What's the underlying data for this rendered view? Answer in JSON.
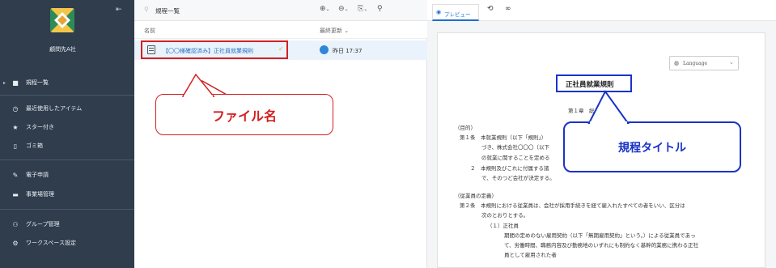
{
  "sidebar": {
    "collapse_icon": "⇤",
    "company": "顧問先A社",
    "items": [
      {
        "icon": "folder-icon",
        "label": "規程一覧",
        "has_caret": true
      },
      {
        "icon": "clock-icon",
        "label": "最近使用したアイテム"
      },
      {
        "icon": "star-icon",
        "label": "スター付き"
      },
      {
        "icon": "trash-icon",
        "label": "ゴミ箱"
      },
      {
        "icon": "e-application-icon",
        "label": "電子申請"
      },
      {
        "icon": "office-icon",
        "label": "事業場管理"
      },
      {
        "icon": "group-icon",
        "label": "グループ管理"
      },
      {
        "icon": "gear-icon",
        "label": "ワークスペース設定"
      }
    ]
  },
  "list": {
    "title": "規程一覧",
    "columns": {
      "name": "名前",
      "updated": "最終更新 ⌄"
    },
    "row": {
      "name": "【〇〇様確認済み】正社員就業規則",
      "updated": "昨日 17:37"
    }
  },
  "preview": {
    "tab_label": "プレビュー",
    "language_label": "Language",
    "doc_title": "正社員就業規則",
    "lines": [
      "第１章　総",
      "（目的）",
      "第１条　本就業規則（以下「規則」）",
      "づき、株式会社〇〇〇（以下",
      "の就業に関することを定める",
      "２　本規則及びこれに付属する諸",
      "で、そのつど会社が決定する。",
      "（従業員の定義）",
      "第２条　本規則における従業員は、会社が採用手続きを経て雇入れたすべての者をいい、区分は",
      "次のとおりとする。",
      "（１）正社員",
      "期間の定めのない雇用契約（以下「無期雇用契約」という。）による従業員であっ",
      "て、労働時間、職務内容及び勤務地のいずれにも制約なく基幹的業務に携わる正社",
      "員として雇用された者"
    ]
  },
  "annotations": {
    "file_name": "ファイル名",
    "doc_title": "規程タイトル"
  },
  "colors": {
    "sidebar_bg": "#2f3d4d",
    "accent_blue": "#1a6fd1",
    "highlight_red": "#d42020",
    "callout_blue": "#1a33c8",
    "link_blue": "#2a6fc2"
  }
}
